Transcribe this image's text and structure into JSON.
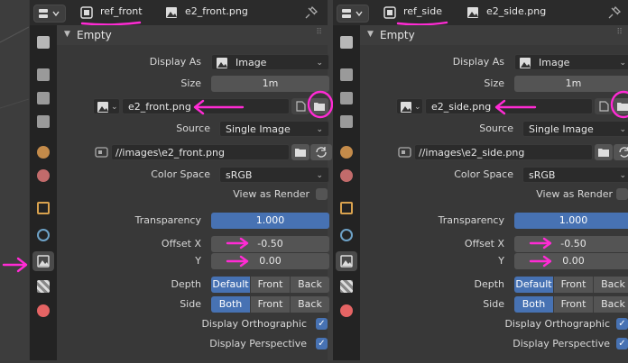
{
  "colors": {
    "accent": "#4772b3",
    "annotation": "#ff2bd4",
    "panel": "#383838",
    "header": "#2b2b2b"
  },
  "panels": [
    {
      "object_name": "ref_front",
      "image_name": "e2_front.png",
      "section_title": "Empty",
      "display_as": {
        "label": "Display As",
        "value": "Image"
      },
      "size": {
        "label": "Size",
        "value": "1m"
      },
      "image_datablock": "e2_front.png",
      "source": {
        "label": "Source",
        "value": "Single Image"
      },
      "filepath": "//images\\e2_front.png",
      "color_space": {
        "label": "Color Space",
        "value": "sRGB"
      },
      "view_as_render": "View as Render",
      "transparency": {
        "label": "Transparency",
        "value": "1.000"
      },
      "offset_x": {
        "label": "Offset X",
        "value": "-0.50"
      },
      "offset_y": {
        "label": "Y",
        "value": "0.00"
      },
      "depth": {
        "label": "Depth",
        "options": [
          "Default",
          "Front",
          "Back"
        ]
      },
      "side": {
        "label": "Side",
        "options": [
          "Both",
          "Front",
          "Back"
        ]
      },
      "display_orthographic": "Display Orthographic",
      "display_perspective": "Display Perspective"
    },
    {
      "object_name": "ref_side",
      "image_name": "e2_side.png",
      "section_title": "Empty",
      "display_as": {
        "label": "Display As",
        "value": "Image"
      },
      "size": {
        "label": "Size",
        "value": "1m"
      },
      "image_datablock": "e2_side.png",
      "source": {
        "label": "Source",
        "value": "Single Image"
      },
      "filepath": "//images\\e2_side.png",
      "color_space": {
        "label": "Color Space",
        "value": "sRGB"
      },
      "view_as_render": "View as Render",
      "transparency": {
        "label": "Transparency",
        "value": "1.000"
      },
      "offset_x": {
        "label": "Offset X",
        "value": "-0.50"
      },
      "offset_y": {
        "label": "Y",
        "value": "0.00"
      },
      "depth": {
        "label": "Depth",
        "options": [
          "Default",
          "Front",
          "Back"
        ]
      },
      "side": {
        "label": "Side",
        "options": [
          "Both",
          "Front",
          "Back"
        ]
      },
      "display_orthographic": "Display Orthographic",
      "display_perspective": "Display Perspective"
    }
  ]
}
